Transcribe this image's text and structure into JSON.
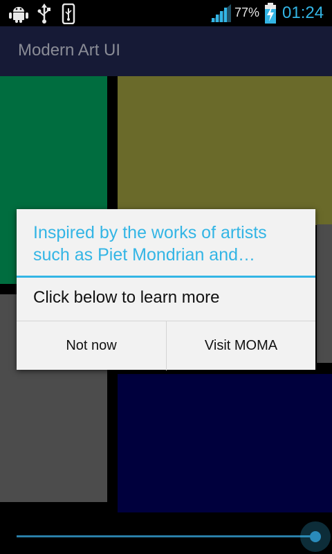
{
  "status_bar": {
    "battery_percent": "77%",
    "time": "01:24",
    "icons": [
      "android-debug-icon",
      "usb-icon",
      "usb-storage-icon",
      "signal-icon",
      "battery-charging-icon"
    ]
  },
  "action_bar": {
    "title": "Modern Art UI"
  },
  "art": {
    "colors": {
      "green": "#006d3f",
      "olive": "#6a6a2a",
      "gray": "#4c4c4c",
      "navy": "#00003d"
    }
  },
  "seekbar": {
    "progress": 1.0
  },
  "dialog": {
    "title": "Inspired by the works of artists such as Piet Mondrian and…",
    "message": "Click below to learn more",
    "negative_label": "Not now",
    "positive_label": "Visit MOMA"
  },
  "theme": {
    "accent": "#33b5e5"
  }
}
